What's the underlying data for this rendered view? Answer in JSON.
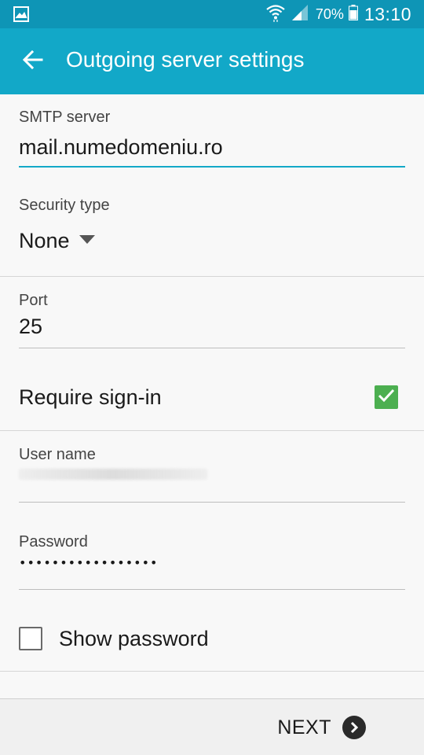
{
  "status_bar": {
    "battery_percent": "70%",
    "time": "13:10",
    "icons": [
      "gallery-icon",
      "wifi-icon",
      "signal-icon",
      "battery-icon"
    ]
  },
  "app_bar": {
    "title": "Outgoing server settings",
    "back_icon": "back-arrow-icon",
    "color": "#12a8c8"
  },
  "form": {
    "smtp_server": {
      "label": "SMTP server",
      "value": "mail.numedomeniu.ro"
    },
    "security_type": {
      "label": "Security type",
      "value": "None"
    },
    "port": {
      "label": "Port",
      "value": "25"
    },
    "require_signin": {
      "label": "Require sign-in",
      "checked": true
    },
    "user_name": {
      "label": "User name",
      "value_redacted": true
    },
    "password": {
      "label": "Password",
      "value": "•••••••••••••••••"
    },
    "show_password": {
      "label": "Show password",
      "checked": false
    }
  },
  "footer": {
    "next_label": "NEXT",
    "next_icon": "chevron-right-circle-icon"
  },
  "colors": {
    "accent": "#12a8c8",
    "status_bar": "#0e95b6",
    "check_green": "#4caf50"
  }
}
